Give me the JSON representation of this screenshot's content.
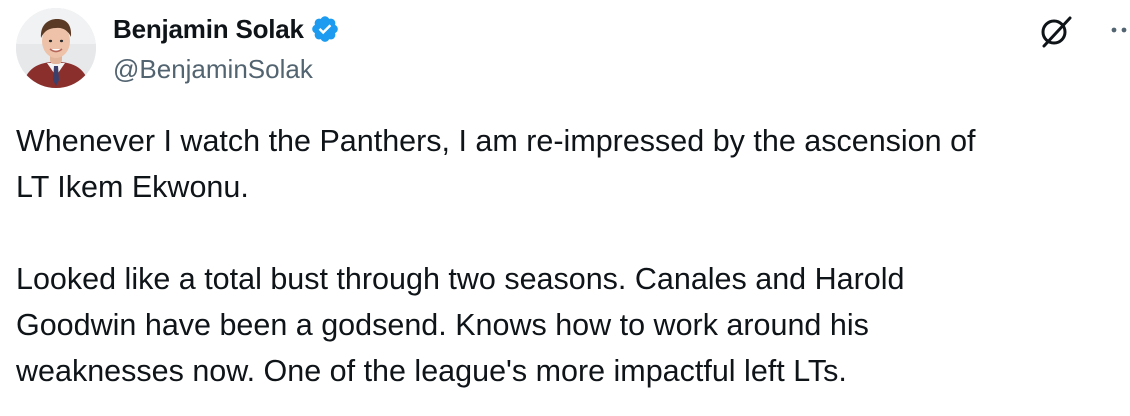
{
  "author": {
    "display_name": "Benjamin Solak",
    "handle": "@BenjaminSolak",
    "verified": true,
    "verified_color": "#1d9bf0"
  },
  "icons": {
    "platform_logo": "x-logo-icon",
    "menu": "more-horizontal-icon",
    "badge": "verified-badge-icon"
  },
  "tweet": {
    "paragraph_1_lines": [
      "Whenever I watch the Panthers, I am re-impressed by the ascension of",
      "LT Ikem Ekwonu."
    ],
    "paragraph_2_lines": [
      "Looked like a total bust through two seasons. Canales and Harold",
      "Goodwin have been a godsend. Knows how to work around his",
      "weaknesses now. One of the league's more impactful left LTs."
    ]
  },
  "colors": {
    "text_primary": "#0f1419",
    "text_secondary": "#536471",
    "background": "#ffffff"
  }
}
